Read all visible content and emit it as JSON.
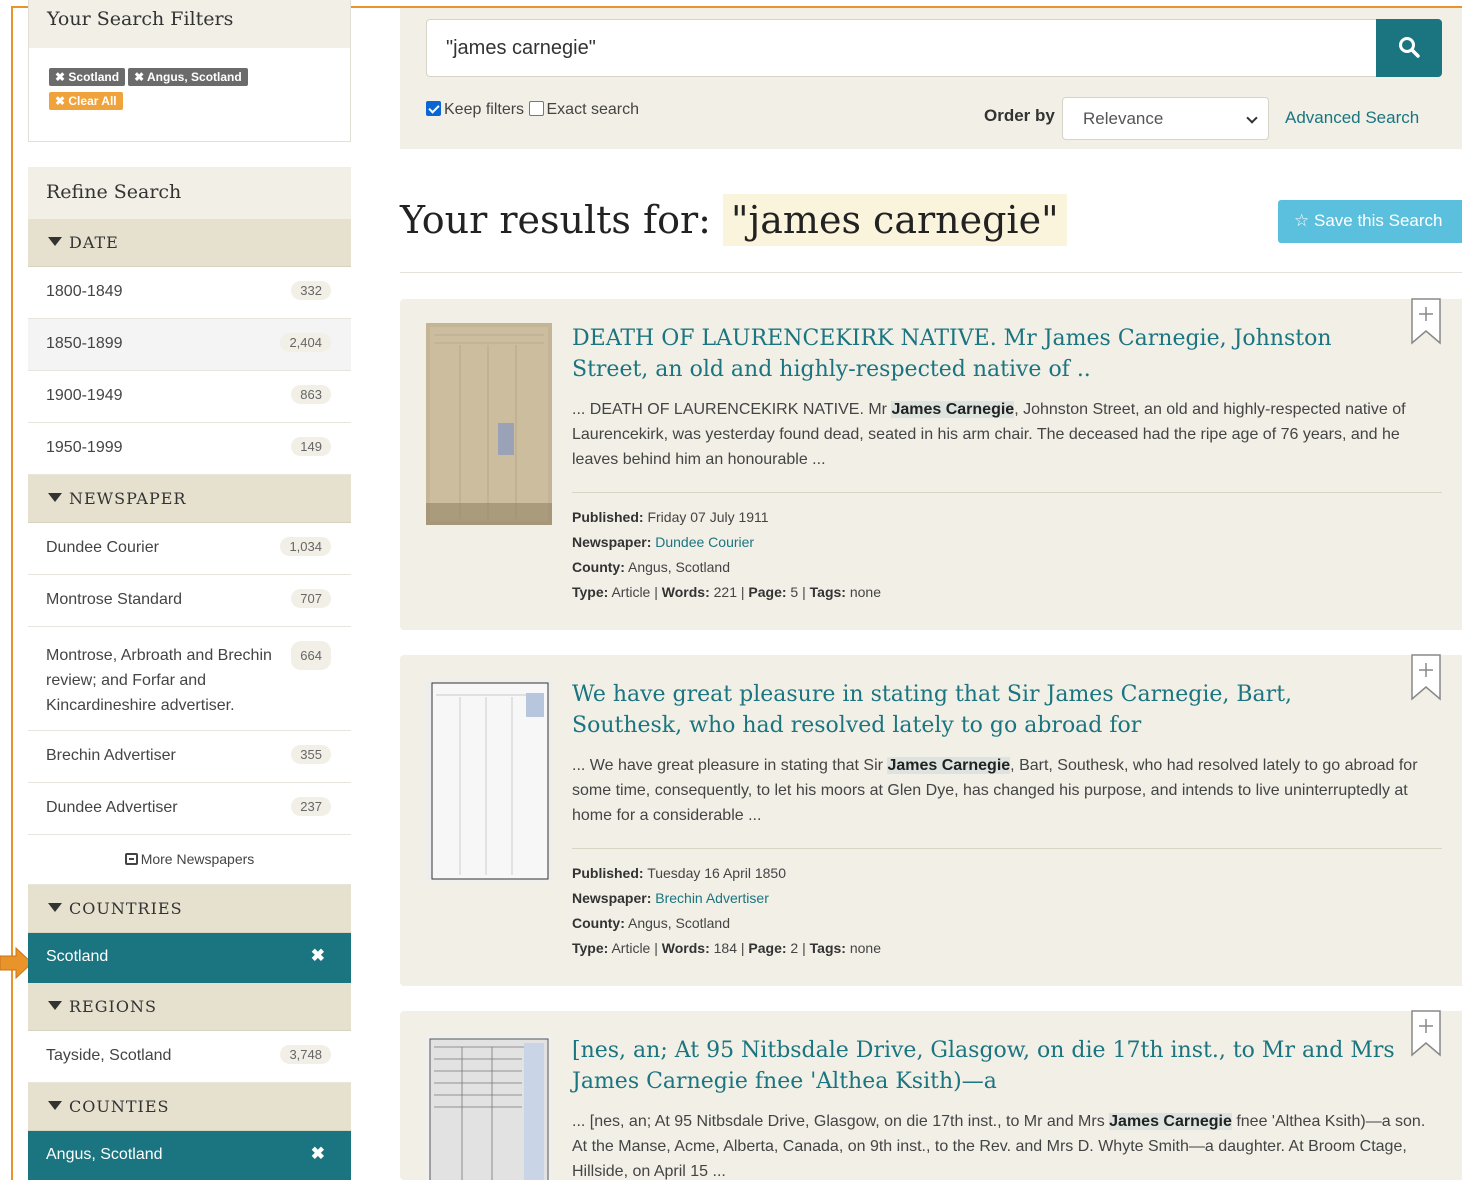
{
  "filters": {
    "title": "Your Search Filters",
    "chips": [
      "Scotland",
      "Angus, Scotland"
    ],
    "clear_label": "Clear All"
  },
  "refine": {
    "title": "Refine Search",
    "date": {
      "heading": "DATE",
      "items": [
        {
          "label": "1800-1849",
          "count": "332"
        },
        {
          "label": "1850-1899",
          "count": "2,404"
        },
        {
          "label": "1900-1949",
          "count": "863"
        },
        {
          "label": "1950-1999",
          "count": "149"
        }
      ]
    },
    "newspaper": {
      "heading": "NEWSPAPER",
      "items": [
        {
          "label": "Dundee Courier",
          "count": "1,034"
        },
        {
          "label": "Montrose Standard",
          "count": "707"
        },
        {
          "label": "Montrose, Arbroath and Brechin review; and Forfar and Kincardineshire advertiser.",
          "count": "664"
        },
        {
          "label": "Brechin Advertiser",
          "count": "355"
        },
        {
          "label": "Dundee Advertiser",
          "count": "237"
        }
      ],
      "more_label": "More Newspapers"
    },
    "countries": {
      "heading": "COUNTRIES",
      "active": "Scotland"
    },
    "regions": {
      "heading": "REGIONS",
      "items": [
        {
          "label": "Tayside, Scotland",
          "count": "3,748"
        }
      ]
    },
    "counties": {
      "heading": "COUNTIES",
      "active": "Angus, Scotland"
    }
  },
  "search": {
    "query": "\"james carnegie\"",
    "keep_filters_label": "Keep filters",
    "exact_search_label": "Exact search",
    "order_by_label": "Order by",
    "order_by_value": "Relevance",
    "advanced_label": "Advanced Search"
  },
  "results": {
    "heading_prefix": "Your results for:",
    "heading_query": "\"james carnegie\"",
    "save_label": "Save this Search",
    "labels": {
      "published": "Published:",
      "newspaper": "Newspaper:",
      "county": "County:",
      "type": "Type:",
      "words": "Words:",
      "page": "Page:",
      "tags": "Tags:"
    },
    "items": [
      {
        "title": "DEATH OF LAURENCEKIRK NATIVE. Mr James Carnegie, Johnston Street, an old and highly-respected native of ..",
        "snippet_pre": "... DEATH OF LAURENCEKIRK NATIVE. Mr ",
        "snippet_hl": "James Carnegie",
        "snippet_post": ", Johnston Street, an old and highly-respected native of Laurencekirk, was yesterday found dead, seated in his arm chair. The deceased had the ripe age of 76 years, and he leaves behind him an honourable ...",
        "published": "Friday 07 July 1911",
        "newspaper": "Dundee Courier",
        "county": "Angus, Scotland",
        "type": "Article",
        "words": "221",
        "page": "5",
        "tags": "none"
      },
      {
        "title": "We have great pleasure in stating that Sir James Carnegie, Bart, Southesk, who had resolved lately to go abroad for",
        "snippet_pre": "... We have great pleasure in stating that Sir ",
        "snippet_hl": "James Carnegie",
        "snippet_post": ", Bart, Southesk, who had resolved lately to go abroad for some time, consequently, to let his moors at Glen Dye, has changed his purpose, and intends to live uninterruptedly at home for a considerable ...",
        "published": "Tuesday 16 April 1850",
        "newspaper": "Brechin Advertiser",
        "county": "Angus, Scotland",
        "type": "Article",
        "words": "184",
        "page": "2",
        "tags": "none"
      },
      {
        "title": "[nes, an; At 95 Nitbsdale Drive, Glasgow, on die 17th inst., to Mr and Mrs James Carnegie fnee 'Althea Ksith)—a",
        "snippet_pre": "... [nes, an; At 95 Nitbsdale Drive, Glasgow, on die 17th inst., to Mr and Mrs ",
        "snippet_hl": "James Carnegie",
        "snippet_post": " fnee 'Althea Ksith)—a son. At the Manse, Acme, Alberta, Canada, on 9th inst., to the Rev. and Mrs D. Whyte Smith—a daughter. At Broom Ctage, Hillside, on April 15 ..."
      }
    ]
  },
  "colors": {
    "teal": "#1a7580",
    "panel": "#f1efe6",
    "facet_head": "#e6e1cf",
    "save": "#5bc0de",
    "orange": "#e8942a"
  }
}
